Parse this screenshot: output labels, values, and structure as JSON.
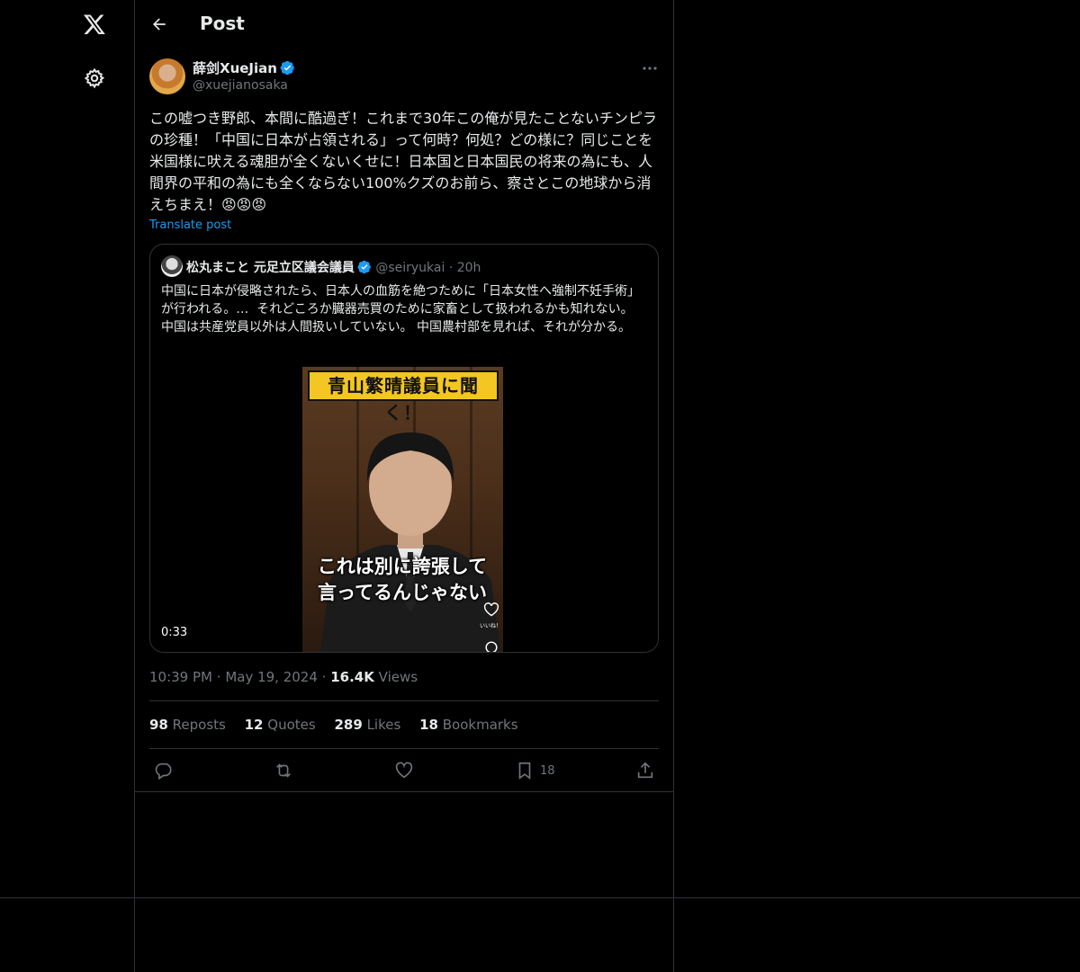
{
  "nav": {
    "logo_icon": "x-logo-icon",
    "settings_icon": "gear-icon"
  },
  "header": {
    "back_icon": "arrow-left-icon",
    "title": "Post"
  },
  "post": {
    "author_name": "薛剑XueJian",
    "author_handle": "@xuejianosaka",
    "text": "この嘘つき野郎、本間に酷過ぎ！これまで30年この俺が見たことないチンピラの珍種！「中国に日本が占領される」って何時？何処？どの様に？同じことを米国様に吠える魂胆が全くないくせに！日本国と日本国民の将来の為にも、人間界の平和の為にも全くならない100%クズのお前ら、察さとこの地球から消えちまえ！😡😡😡",
    "translate_label": "Translate post",
    "time": "10:39 PM",
    "date": "May 19, 2024",
    "views_count": "16.4K",
    "views_label": "Views"
  },
  "quote": {
    "author_name": "松丸まこと 元足立区議会議員",
    "author_handle": "@seiryukai",
    "age": "20h",
    "text": "中国に日本が侵略されたら、日本人の血筋を絶つために「日本女性へ強制不妊手術」が行われる。…  それどころか臓器売買のために家畜として扱われるかも知れない。 中国は共産党員以外は人間扱いしていない。 中国農村部を見れば、それが分かる。",
    "video": {
      "banner": "青山繁晴議員に聞く！",
      "caption_line1": "これは別に誇張して",
      "caption_line2": "言ってるんじゃない",
      "small_text": "いいね！",
      "duration": "0:33"
    }
  },
  "stats": {
    "reposts_count": "98",
    "reposts_label": "Reposts",
    "quotes_count": "12",
    "quotes_label": "Quotes",
    "likes_count": "289",
    "likes_label": "Likes",
    "bookmarks_count": "18",
    "bookmarks_label": "Bookmarks"
  },
  "actions": {
    "reply_icon": "reply-icon",
    "repost_icon": "repost-icon",
    "like_icon": "heart-icon",
    "bookmark_icon": "bookmark-icon",
    "bookmark_count": "18",
    "share_icon": "share-icon"
  },
  "colors": {
    "background": "#000000",
    "text": "#e7e9ea",
    "muted": "#71767b",
    "accent": "#1d9bf0",
    "border": "#2f3336"
  }
}
